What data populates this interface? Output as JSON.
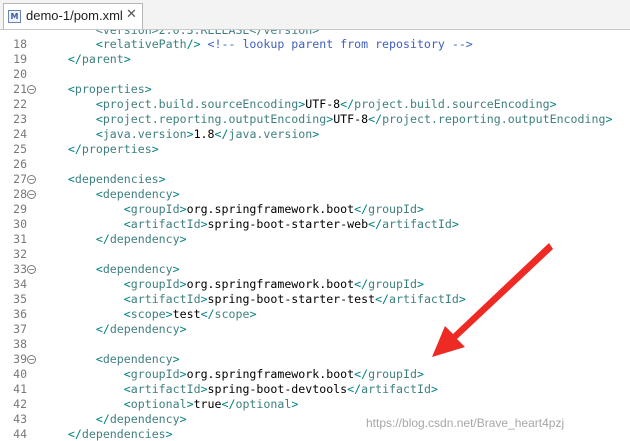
{
  "tab": {
    "title": "demo-1/pom.xml",
    "close": "✕",
    "icon": "M"
  },
  "editor": {
    "lines": [
      {
        "n": "18",
        "parts": [
          {
            "c": "br",
            "t": "        <"
          },
          {
            "c": "tag",
            "t": "relativePath"
          },
          {
            "c": "br",
            "t": "/> "
          },
          {
            "c": "cmt",
            "t": "<!-- lookup parent from repository -->"
          }
        ]
      },
      {
        "n": "19",
        "parts": [
          {
            "c": "br",
            "t": "    </"
          },
          {
            "c": "tag",
            "t": "parent"
          },
          {
            "c": "br",
            "t": ">"
          }
        ]
      },
      {
        "n": "20",
        "parts": []
      },
      {
        "n": "21",
        "fold": true,
        "parts": [
          {
            "c": "br",
            "t": "    <"
          },
          {
            "c": "tag",
            "t": "properties"
          },
          {
            "c": "br",
            "t": ">"
          }
        ]
      },
      {
        "n": "22",
        "parts": [
          {
            "c": "br",
            "t": "        <"
          },
          {
            "c": "tag",
            "t": "project.build.sourceEncoding"
          },
          {
            "c": "br",
            "t": ">"
          },
          {
            "c": "txt",
            "t": "UTF-8"
          },
          {
            "c": "br",
            "t": "</"
          },
          {
            "c": "tag",
            "t": "project.build.sourceEncoding"
          },
          {
            "c": "br",
            "t": ">"
          }
        ]
      },
      {
        "n": "23",
        "parts": [
          {
            "c": "br",
            "t": "        <"
          },
          {
            "c": "tag",
            "t": "project.reporting.outputEncoding"
          },
          {
            "c": "br",
            "t": ">"
          },
          {
            "c": "txt",
            "t": "UTF-8"
          },
          {
            "c": "br",
            "t": "</"
          },
          {
            "c": "tag",
            "t": "project.reporting.outputEncoding"
          },
          {
            "c": "br",
            "t": ">"
          }
        ]
      },
      {
        "n": "24",
        "parts": [
          {
            "c": "br",
            "t": "        <"
          },
          {
            "c": "tag",
            "t": "java.version"
          },
          {
            "c": "br",
            "t": ">"
          },
          {
            "c": "txt",
            "t": "1.8"
          },
          {
            "c": "br",
            "t": "</"
          },
          {
            "c": "tag",
            "t": "java.version"
          },
          {
            "c": "br",
            "t": ">"
          }
        ]
      },
      {
        "n": "25",
        "parts": [
          {
            "c": "br",
            "t": "    </"
          },
          {
            "c": "tag",
            "t": "properties"
          },
          {
            "c": "br",
            "t": ">"
          }
        ]
      },
      {
        "n": "26",
        "parts": []
      },
      {
        "n": "27",
        "fold": true,
        "parts": [
          {
            "c": "br",
            "t": "    <"
          },
          {
            "c": "tag",
            "t": "dependencies"
          },
          {
            "c": "br",
            "t": ">"
          }
        ]
      },
      {
        "n": "28",
        "fold": true,
        "parts": [
          {
            "c": "br",
            "t": "        <"
          },
          {
            "c": "tag",
            "t": "dependency"
          },
          {
            "c": "br",
            "t": ">"
          }
        ]
      },
      {
        "n": "29",
        "parts": [
          {
            "c": "br",
            "t": "            <"
          },
          {
            "c": "tag",
            "t": "groupId"
          },
          {
            "c": "br",
            "t": ">"
          },
          {
            "c": "txt",
            "t": "org.springframework.boot"
          },
          {
            "c": "br",
            "t": "</"
          },
          {
            "c": "tag",
            "t": "groupId"
          },
          {
            "c": "br",
            "t": ">"
          }
        ]
      },
      {
        "n": "30",
        "parts": [
          {
            "c": "br",
            "t": "            <"
          },
          {
            "c": "tag",
            "t": "artifactId"
          },
          {
            "c": "br",
            "t": ">"
          },
          {
            "c": "txt",
            "t": "spring-boot-starter-web"
          },
          {
            "c": "br",
            "t": "</"
          },
          {
            "c": "tag",
            "t": "artifactId"
          },
          {
            "c": "br",
            "t": ">"
          }
        ]
      },
      {
        "n": "31",
        "parts": [
          {
            "c": "br",
            "t": "        </"
          },
          {
            "c": "tag",
            "t": "dependency"
          },
          {
            "c": "br",
            "t": ">"
          }
        ]
      },
      {
        "n": "32",
        "parts": []
      },
      {
        "n": "33",
        "fold": true,
        "parts": [
          {
            "c": "br",
            "t": "        <"
          },
          {
            "c": "tag",
            "t": "dependency"
          },
          {
            "c": "br",
            "t": ">"
          }
        ]
      },
      {
        "n": "34",
        "parts": [
          {
            "c": "br",
            "t": "            <"
          },
          {
            "c": "tag",
            "t": "groupId"
          },
          {
            "c": "br",
            "t": ">"
          },
          {
            "c": "txt",
            "t": "org.springframework.boot"
          },
          {
            "c": "br",
            "t": "</"
          },
          {
            "c": "tag",
            "t": "groupId"
          },
          {
            "c": "br",
            "t": ">"
          }
        ]
      },
      {
        "n": "35",
        "parts": [
          {
            "c": "br",
            "t": "            <"
          },
          {
            "c": "tag",
            "t": "artifactId"
          },
          {
            "c": "br",
            "t": ">"
          },
          {
            "c": "txt",
            "t": "spring-boot-starter-test"
          },
          {
            "c": "br",
            "t": "</"
          },
          {
            "c": "tag",
            "t": "artifactId"
          },
          {
            "c": "br",
            "t": ">"
          }
        ]
      },
      {
        "n": "36",
        "parts": [
          {
            "c": "br",
            "t": "            <"
          },
          {
            "c": "tag",
            "t": "scope"
          },
          {
            "c": "br",
            "t": ">"
          },
          {
            "c": "txt",
            "t": "test"
          },
          {
            "c": "br",
            "t": "</"
          },
          {
            "c": "tag",
            "t": "scope"
          },
          {
            "c": "br",
            "t": ">"
          }
        ]
      },
      {
        "n": "37",
        "parts": [
          {
            "c": "br",
            "t": "        </"
          },
          {
            "c": "tag",
            "t": "dependency"
          },
          {
            "c": "br",
            "t": ">"
          }
        ]
      },
      {
        "n": "38",
        "parts": []
      },
      {
        "n": "39",
        "fold": true,
        "parts": [
          {
            "c": "br",
            "t": "        <"
          },
          {
            "c": "tag",
            "t": "dependency"
          },
          {
            "c": "br",
            "t": ">"
          }
        ]
      },
      {
        "n": "40",
        "parts": [
          {
            "c": "br",
            "t": "            <"
          },
          {
            "c": "tag",
            "t": "groupId"
          },
          {
            "c": "br",
            "t": ">"
          },
          {
            "c": "txt",
            "t": "org.springframework.boot"
          },
          {
            "c": "br",
            "t": "</"
          },
          {
            "c": "tag",
            "t": "groupId"
          },
          {
            "c": "br",
            "t": ">"
          }
        ]
      },
      {
        "n": "41",
        "parts": [
          {
            "c": "br",
            "t": "            <"
          },
          {
            "c": "tag",
            "t": "artifactId"
          },
          {
            "c": "br",
            "t": ">"
          },
          {
            "c": "txt",
            "t": "spring-boot-devtools"
          },
          {
            "c": "br",
            "t": "</"
          },
          {
            "c": "tag",
            "t": "artifactId"
          },
          {
            "c": "br",
            "t": ">"
          }
        ]
      },
      {
        "n": "42",
        "parts": [
          {
            "c": "br",
            "t": "            <"
          },
          {
            "c": "tag",
            "t": "optional"
          },
          {
            "c": "br",
            "t": ">"
          },
          {
            "c": "txt",
            "t": "true"
          },
          {
            "c": "br",
            "t": "</"
          },
          {
            "c": "tag",
            "t": "optional"
          },
          {
            "c": "br",
            "t": ">"
          }
        ]
      },
      {
        "n": "43",
        "parts": [
          {
            "c": "br",
            "t": "        </"
          },
          {
            "c": "tag",
            "t": "dependency"
          },
          {
            "c": "br",
            "t": ">"
          }
        ]
      },
      {
        "n": "44",
        "parts": [
          {
            "c": "br",
            "t": "    </"
          },
          {
            "c": "tag",
            "t": "dependencies"
          },
          {
            "c": "br",
            "t": ">"
          }
        ]
      }
    ]
  },
  "watermark": "https://blog.csdn.net/Brave_heart4pzj",
  "colors": {
    "tag": "#3f7f7f",
    "bracket": "#008080",
    "comment": "#3f5fbf",
    "arrow": "#ee2a24"
  }
}
